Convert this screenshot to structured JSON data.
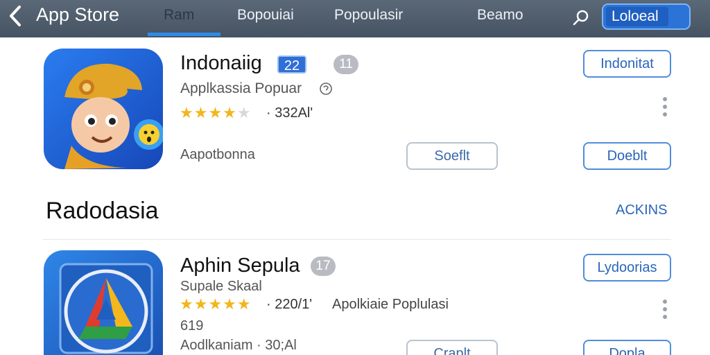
{
  "header": {
    "back_icon": "chevron-left-icon",
    "title": "App Store",
    "tabs": [
      {
        "label": "Ram",
        "active": true
      },
      {
        "label": "Bopouiai",
        "active": false
      },
      {
        "label": "Popoulasir",
        "active": false
      },
      {
        "label": "Beamo",
        "active": false
      }
    ],
    "search_icon": "search-icon",
    "locale_button": "Loloeal"
  },
  "apps": [
    {
      "name": "Indonaiig",
      "badge": "22",
      "count_badge": "11",
      "subtitle": "Applkassia Popuar",
      "rating_stars": 4,
      "rating_count": "· 332Al'",
      "meta": "Aapotbonna",
      "top_button": "Indonitat",
      "secondary_button": "Soeflt",
      "primary_button": "Doeblt"
    },
    {
      "name": "Aphin Sepula",
      "count_badge": "17",
      "subtitle": "Supale Skaal",
      "rating_stars": 5,
      "rating_count": "· 220/1'",
      "rating_extra": "Apolkiaie Poplulasi",
      "meta_top": "619",
      "meta": "Aodlkaniam · 30;Al",
      "top_button": "Lydoorias",
      "secondary_button": "Craplt",
      "primary_button": "Dopla"
    }
  ],
  "section": {
    "title": "Radodasia",
    "link": "ACKINS"
  },
  "colors": {
    "accent": "#2f8be8",
    "topbar": "#4f5d6c",
    "star": "#f2b51c"
  }
}
